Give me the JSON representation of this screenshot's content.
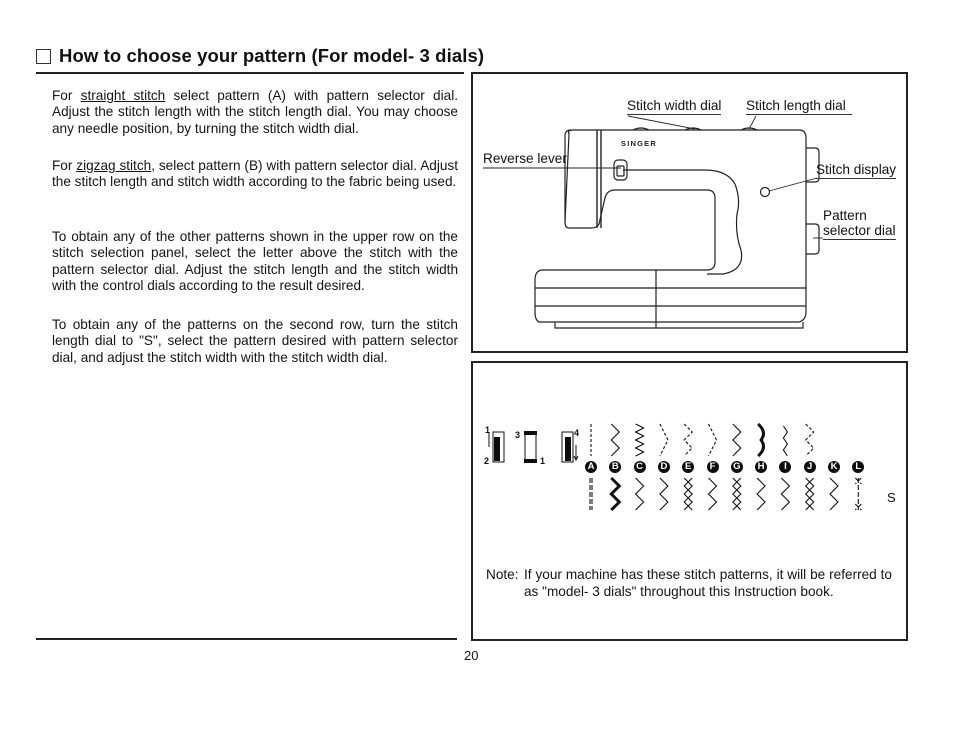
{
  "header": {
    "title": "How to choose your pattern (For model- 3 dials)"
  },
  "paragraphs": {
    "p1": {
      "before": "For ",
      "underlined": "straight stitch",
      "after": " select pattern (A) with pattern selector dial. Adjust the stitch length with the stitch length dial. You may choose any needle position, by turning the stitch width dial."
    },
    "p2": {
      "before": "For ",
      "underlined": "zigzag stitch",
      "after": ", select pattern (B) with pattern selector dial. Adjust the stitch length and stitch width according to the fabric being used."
    },
    "p3": "To obtain any of the other patterns shown in the upper row on the stitch selection panel, select the letter above the stitch with the pattern selector dial. Adjust the stitch length and the stitch width with the control dials according to the result desired.",
    "p4": "To obtain any of the patterns on the second row, turn the stitch length dial to \"S\", select the pattern desired with pattern selector dial, and adjust the stitch width with the stitch width dial."
  },
  "machine_diagram": {
    "brand": "SINGER",
    "labels": {
      "stitch_width_dial": "Stitch width dial",
      "stitch_length_dial": "Stitch length dial",
      "reverse_lever": "Reverse lever",
      "stitch_display": "Stitch display",
      "pattern_selector_line1": "Pattern",
      "pattern_selector_line2": "selector dial"
    }
  },
  "stitch_panel": {
    "needle_positions": [
      "1",
      "2",
      "3",
      "1",
      "4"
    ],
    "letters": [
      "A",
      "B",
      "C",
      "D",
      "E",
      "F",
      "G",
      "H",
      "I",
      "J",
      "K",
      "L"
    ],
    "second_row_setting": "S"
  },
  "note": {
    "label": "Note:",
    "text": "If your machine has these stitch patterns, it will be referred to as \"model- 3 dials\" throughout this Instruction book."
  },
  "footer": {
    "page_number": "20"
  }
}
